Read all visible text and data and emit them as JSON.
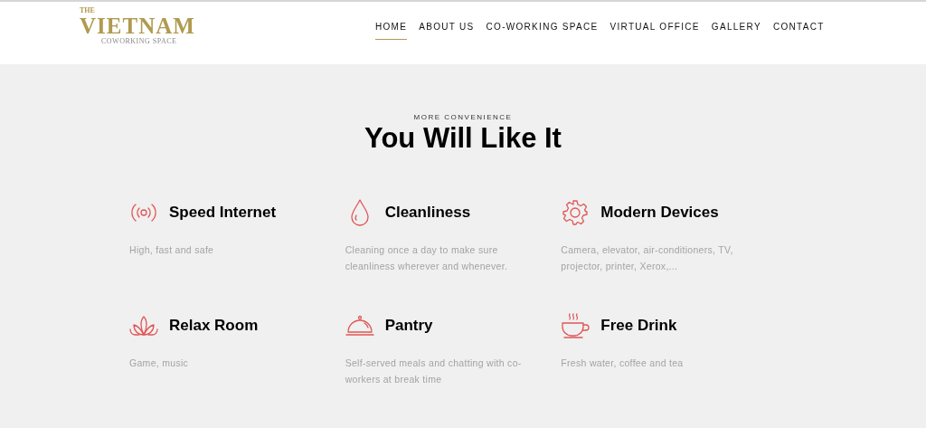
{
  "logo": {
    "small": "THE",
    "main": "VIETNAM",
    "sub": "COWORKING SPACE"
  },
  "nav": [
    {
      "label": "HOME",
      "selected": true
    },
    {
      "label": "ABOUT US",
      "selected": false
    },
    {
      "label": "CO-WORKING SPACE",
      "selected": false
    },
    {
      "label": "VIRTUAL OFFICE",
      "selected": false
    },
    {
      "label": "GALLERY",
      "selected": false
    },
    {
      "label": "CONTACT",
      "selected": false
    }
  ],
  "section": {
    "eyebrow": "MORE CONVENIENCE",
    "title": "You Will Like It"
  },
  "features": [
    {
      "kind": "signal",
      "title": "Speed Internet",
      "text": "High, fast and safe"
    },
    {
      "kind": "drop",
      "title": "Cleanliness",
      "text": "Cleaning once a day to make sure cleanliness wherever and whenever."
    },
    {
      "kind": "gear",
      "title": "Modern Devices",
      "text": "Camera, elevator, air-conditioners, TV, projector, printer, Xerox,..."
    },
    {
      "kind": "lotus",
      "title": "Relax Room",
      "text": "Game, music"
    },
    {
      "kind": "cloche",
      "title": "Pantry",
      "text": "Self-served meals and chatting with co-workers at break time"
    },
    {
      "kind": "cup",
      "title": "Free Drink",
      "text": "Fresh water, coffee and tea"
    }
  ]
}
